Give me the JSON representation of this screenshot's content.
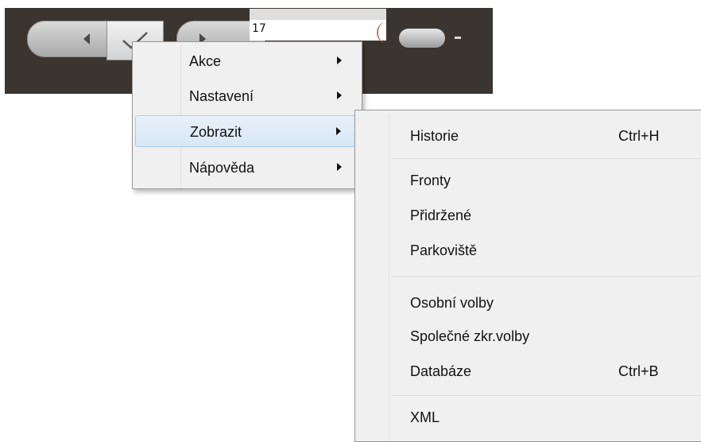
{
  "toolbar": {
    "field_value": "17",
    "icons": {
      "back": "chevron-left-icon",
      "ok": "checkmark-icon",
      "forward": "chevron-right-icon"
    },
    "colors": {
      "toolbar_bg": "#3b3532",
      "menu_bg": "#f0f0f0",
      "highlight": "#d8e6f5"
    }
  },
  "context_menu": {
    "items": [
      {
        "label": "Akce"
      },
      {
        "label": "Nastavení"
      },
      {
        "label": "Zobrazit"
      },
      {
        "label": "Nápověda"
      }
    ]
  },
  "submenu": {
    "items": [
      {
        "label": "Historie",
        "shortcut": "Ctrl+H"
      },
      {
        "label": "Fronty"
      },
      {
        "label": "Přidržené"
      },
      {
        "label": "Parkoviště"
      },
      {
        "label": "Osobní volby"
      },
      {
        "label": "Společné zkr.volby"
      },
      {
        "label": "Databáze",
        "shortcut": "Ctrl+B"
      },
      {
        "label": "XML"
      }
    ]
  }
}
